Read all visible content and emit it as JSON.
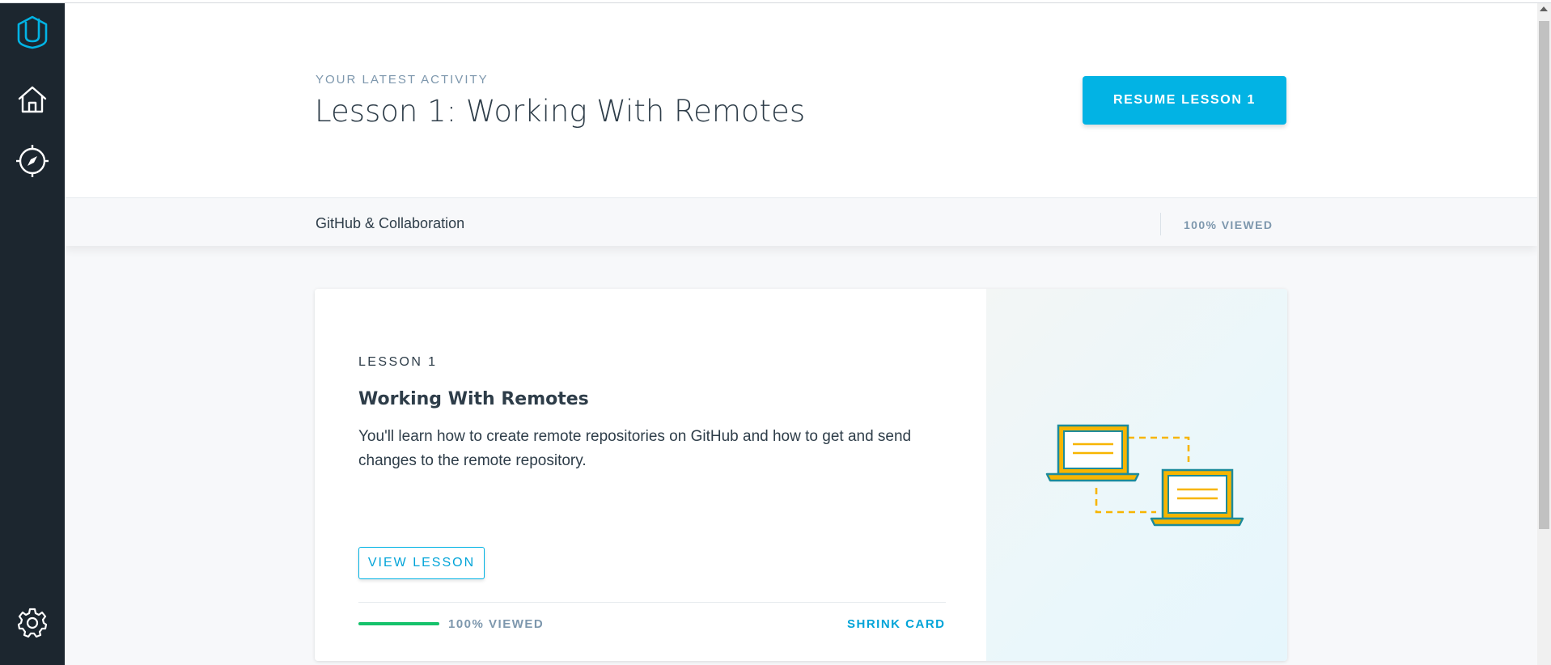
{
  "sidebar": {
    "logo_icon": "udacity-logo-icon",
    "items": [
      {
        "name": "home",
        "icon": "home-icon"
      },
      {
        "name": "explore",
        "icon": "compass-icon"
      },
      {
        "name": "settings",
        "icon": "gear-icon"
      }
    ]
  },
  "hero": {
    "kicker": "YOUR LATEST ACTIVITY",
    "title": "Lesson 1: Working With Remotes",
    "resume_label": "RESUME LESSON 1"
  },
  "course_bar": {
    "course_name": "GitHub & Collaboration",
    "progress_text": "100% VIEWED"
  },
  "lesson_card": {
    "label": "LESSON 1",
    "title": "Working With Remotes",
    "description": "You'll learn how to create remote repositories on GitHub and how to get and send changes to the remote repository.",
    "view_label": "VIEW LESSON",
    "progress_fraction": 1.0,
    "viewed_text": "100% VIEWED",
    "shrink_label": "SHRINK CARD",
    "illustration_icon": "two-laptops-sync-icon"
  },
  "colors": {
    "sidebar_bg": "#1c262f",
    "accent": "#02b3e4",
    "progress_green": "#15c26b",
    "text_dark": "#2e3d49",
    "text_muted": "#7d97ad",
    "illustration_teal": "#1d8b9b",
    "illustration_gold": "#f7b500"
  }
}
